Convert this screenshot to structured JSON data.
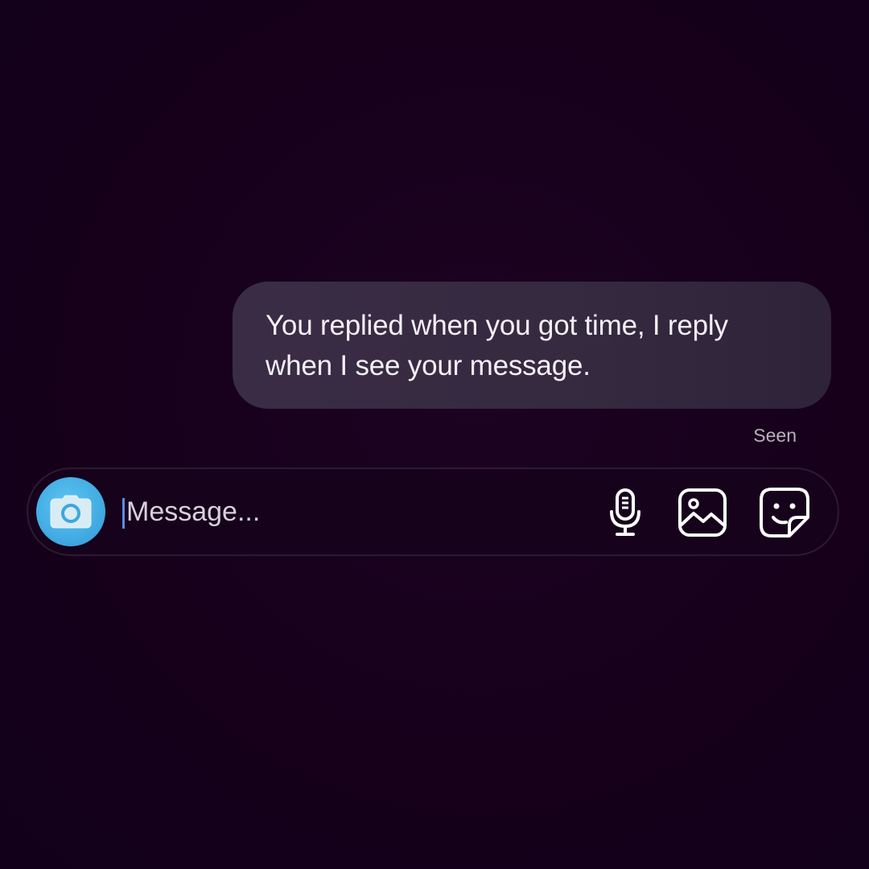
{
  "conversation": {
    "messages": [
      {
        "text": "You replied when you got time, I reply when I see your message.",
        "sender": "self"
      }
    ],
    "status": "Seen"
  },
  "composer": {
    "placeholder": "Message...",
    "value": "",
    "icons": {
      "camera": "camera-icon",
      "mic": "microphone-icon",
      "gallery": "image-gallery-icon",
      "sticker": "sticker-icon"
    }
  },
  "colors": {
    "background": "#16001a",
    "bubble": "#382a43",
    "camera_button": "#3ea7e0",
    "caret": "#5b8de8"
  }
}
